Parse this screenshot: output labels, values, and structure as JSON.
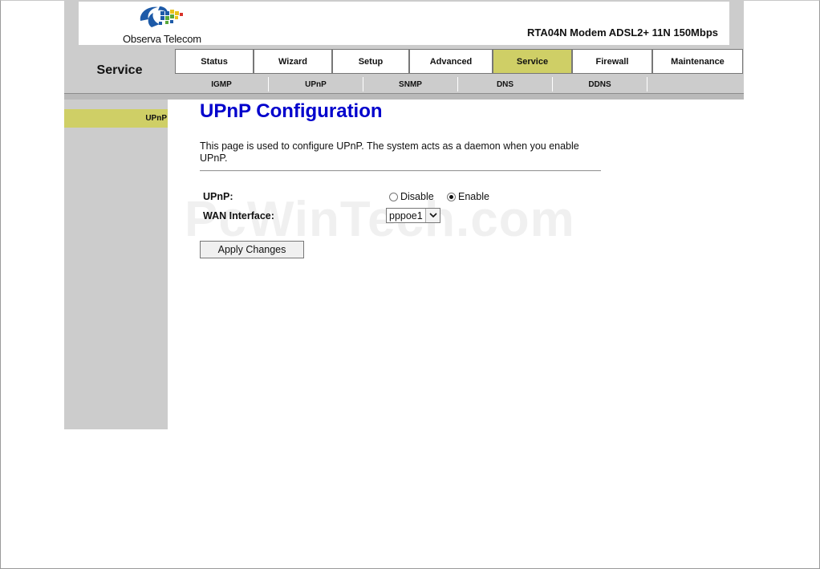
{
  "header": {
    "brand_name": "Observa Telecom",
    "model": "RTA04N Modem ADSL2+ 11N 150Mbps",
    "section_title": "Service",
    "logo_icon": "observa-telecom-logo-icon",
    "colors": {
      "logo_blue": "#1d5aa8",
      "logo_yellow": "#e8c21a",
      "logo_green": "#59a83a",
      "logo_red": "#d8322a"
    }
  },
  "tabs": [
    {
      "label": "Status"
    },
    {
      "label": "Wizard"
    },
    {
      "label": "Setup"
    },
    {
      "label": "Advanced"
    },
    {
      "label": "Service"
    },
    {
      "label": "Firewall"
    },
    {
      "label": "Maintenance"
    }
  ],
  "active_tab": "Service",
  "subtabs": [
    {
      "label": "IGMP"
    },
    {
      "label": "UPnP"
    },
    {
      "label": "SNMP"
    },
    {
      "label": "DNS"
    },
    {
      "label": "DDNS"
    }
  ],
  "sidebar": {
    "items": [
      {
        "label": "UPnP"
      }
    ]
  },
  "main": {
    "title": "UPnP Configuration",
    "description": "This page is used to configure UPnP. The system acts as a daemon when you enable UPnP.",
    "upnp_label": "UPnP:",
    "disable_label": "Disable",
    "enable_label": "Enable",
    "upnp_selected": "Enable",
    "wan_label": "WAN Interface:",
    "wan_value": "pppoe1",
    "apply_label": "Apply Changes"
  },
  "watermark": "PcWinTech.com",
  "colors": {
    "accent_active": "#cfcf66",
    "title_blue": "#0000cc",
    "panel_gray": "#cccccc"
  }
}
